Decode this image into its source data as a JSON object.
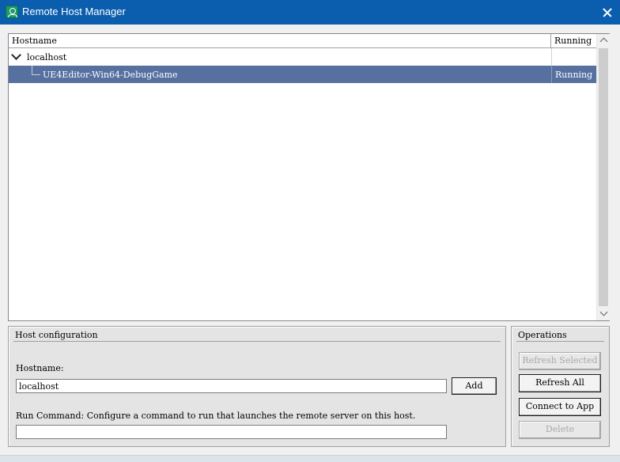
{
  "window": {
    "title": "Remote Host Manager",
    "icon": "app-user-icon",
    "accent": "#0b5ead"
  },
  "tree": {
    "columns": [
      "Hostname",
      "Running"
    ],
    "rows": [
      {
        "label": "localhost",
        "running": "",
        "expanded": true
      },
      {
        "label": "UE4Editor-Win64-DebugGame",
        "running": "Running",
        "selected": true
      }
    ],
    "selection_color": "#5670a0"
  },
  "host_config": {
    "title": "Host configuration",
    "hostname_label": "Hostname:",
    "hostname_value": "localhost",
    "add_label": "Add",
    "run_command_label": "Run Command: Configure a command to run that launches the remote server on this host.",
    "run_command_value": ""
  },
  "operations": {
    "title": "Operations",
    "refresh_selected": "Refresh Selected",
    "refresh_all": "Refresh All",
    "connect": "Connect to App",
    "delete": "Delete"
  }
}
